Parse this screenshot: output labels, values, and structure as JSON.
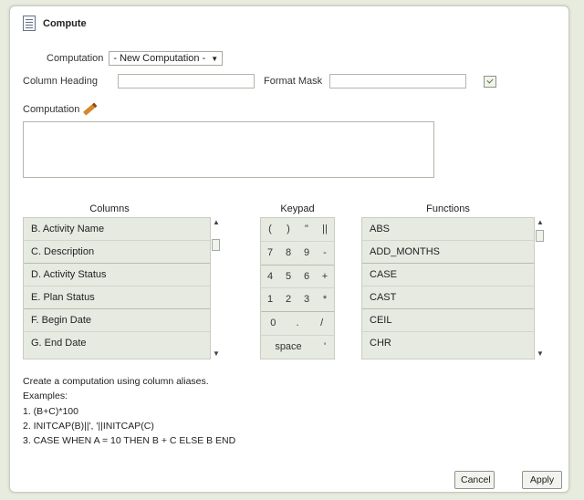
{
  "dialog": {
    "title": "Compute",
    "title_icon": "document-icon"
  },
  "computation_select": {
    "label": "Computation",
    "value": "- New Computation -"
  },
  "column_heading": {
    "label": "Column Heading",
    "value": ""
  },
  "format_mask": {
    "label": "Format Mask",
    "value": ""
  },
  "computation": {
    "label": "Computation",
    "value": ""
  },
  "columns": {
    "title": "Columns",
    "items": [
      "B.   Activity Name",
      "C.   Description",
      "D.   Activity Status",
      "E.   Plan Status",
      "F.   Begin Date",
      "G.   End Date"
    ]
  },
  "keypad": {
    "title": "Keypad",
    "rows": [
      [
        "(",
        ")",
        "\"",
        "||"
      ],
      [
        "7",
        "8",
        "9",
        "-"
      ],
      [
        "4",
        "5",
        "6",
        "+"
      ],
      [
        "1",
        "2",
        "3",
        "*"
      ],
      [
        "0",
        ".",
        "/"
      ],
      [
        "space",
        "'"
      ]
    ]
  },
  "functions": {
    "title": "Functions",
    "items": [
      "ABS",
      "ADD_MONTHS",
      "CASE",
      "CAST",
      "CEIL",
      "CHR"
    ]
  },
  "instructions": [
    "Create a computation using column aliases.",
    "Examples:",
    "1. (B+C)*100",
    "2. INITCAP(B)||', '||INITCAP(C)",
    "3. CASE WHEN A = 10 THEN B + C ELSE B END"
  ],
  "buttons": {
    "cancel": "Cancel",
    "apply": "Apply"
  }
}
